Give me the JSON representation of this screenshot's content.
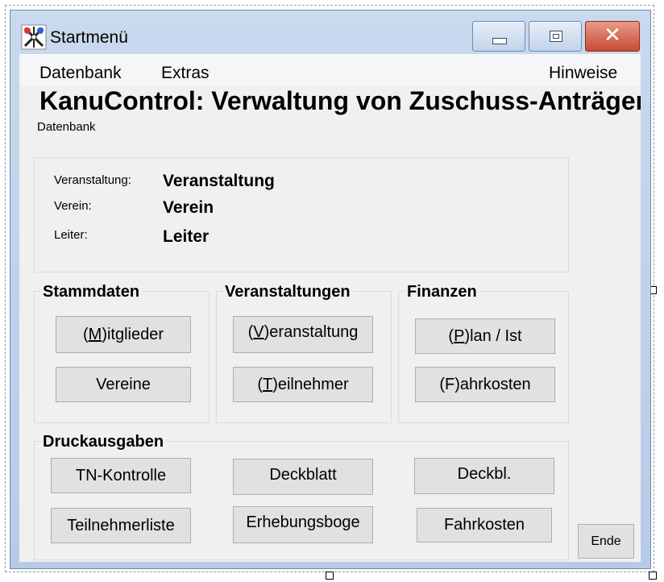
{
  "window": {
    "title": "Startmenü",
    "minimize_label": "",
    "maximize_label": "",
    "close_glyph": "✕"
  },
  "menu": {
    "items": [
      {
        "label": "Datenbank"
      },
      {
        "label": "Extras"
      },
      {
        "label": "Hinweise"
      }
    ]
  },
  "heading": "KanuControl: Verwaltung von Zuschuss-Anträgen",
  "sublabel": "Datenbank",
  "info": {
    "veranstaltung_label": "Veranstaltung:",
    "veranstaltung_value": "Veranstaltung",
    "verein_label": "Verein:",
    "verein_value": "Verein",
    "leiter_label": "Leiter:",
    "leiter_value": "Leiter"
  },
  "groups": {
    "stammdaten": {
      "title": "Stammdaten",
      "mitglieder": {
        "pre": "(",
        "mnemonic": "M",
        "post": ")itglieder"
      },
      "vereine": "Vereine"
    },
    "veranstaltungen": {
      "title": "Veranstaltungen",
      "veranstaltung": {
        "pre": "(",
        "mnemonic": "V",
        "post": ")eranstaltung"
      },
      "teilnehmer": {
        "pre": "(",
        "mnemonic": "T",
        "post": ")eilnehmer"
      }
    },
    "finanzen": {
      "title": "Finanzen",
      "plan_ist": {
        "pre": "(",
        "mnemonic": "P",
        "post": ")lan / Ist"
      },
      "fahrkosten": "(F)ahrkosten"
    },
    "druckausgaben": {
      "title": "Druckausgaben",
      "tn_kontrolle": "TN-Kontrolle",
      "deckblatt": "Deckblatt",
      "deckbl": "Deckbl.",
      "teilnehmerliste": "Teilnehmerliste",
      "erhebungsboge": "Erhebungsboge",
      "fahrkosten": "Fahrkosten"
    }
  },
  "ende_label": "Ende",
  "colors": {
    "client_bg": "#f0f0f0",
    "button_bg": "#e1e1e1",
    "title_bg": "#c9d9ee",
    "close_red": "#c94a34"
  }
}
